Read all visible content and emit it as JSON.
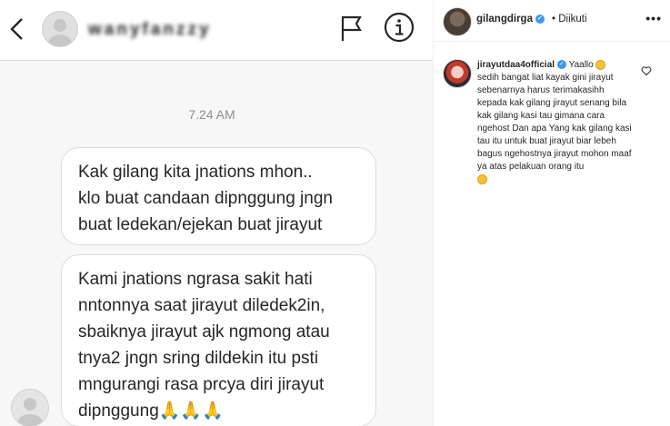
{
  "dm": {
    "username": "wanyfanzzy",
    "timestamp": "7.24 AM",
    "messages": [
      "Kak gilang kita jnations mhon..\nklo buat candaan dipnggung jngn\nbuat ledekan/ejekan buat jirayut",
      "Kami jnations ngrasa sakit hati\nnntonnya saat jirayut diledek2in,\nsbaiknya jirayut ajk ngmong atau\ntnya2 jngn sring dildekin itu psti\nmngurangi rasa prcya diri jirayut\ndipnggung🙏🙏🙏"
    ]
  },
  "ig": {
    "post_author": "gilangdirga",
    "follow_status": "• Diikuti",
    "more": "•••",
    "comment_author": "jirayutdaa4official",
    "comment_text": "Yaallo",
    "comment_body": "sedih bangat liat kayak gini jirayut sebenarnya harus terimakasihh kepada kak gilang jirayut senang bila kak gilang kasi tau gimana cara ngehost Dan apa Yang kak gilang kasi tau itu untuk buat jirayut biar lebeh bagus ngehostnya jirayut mohon maaf ya atas pelakuan orang itu"
  }
}
